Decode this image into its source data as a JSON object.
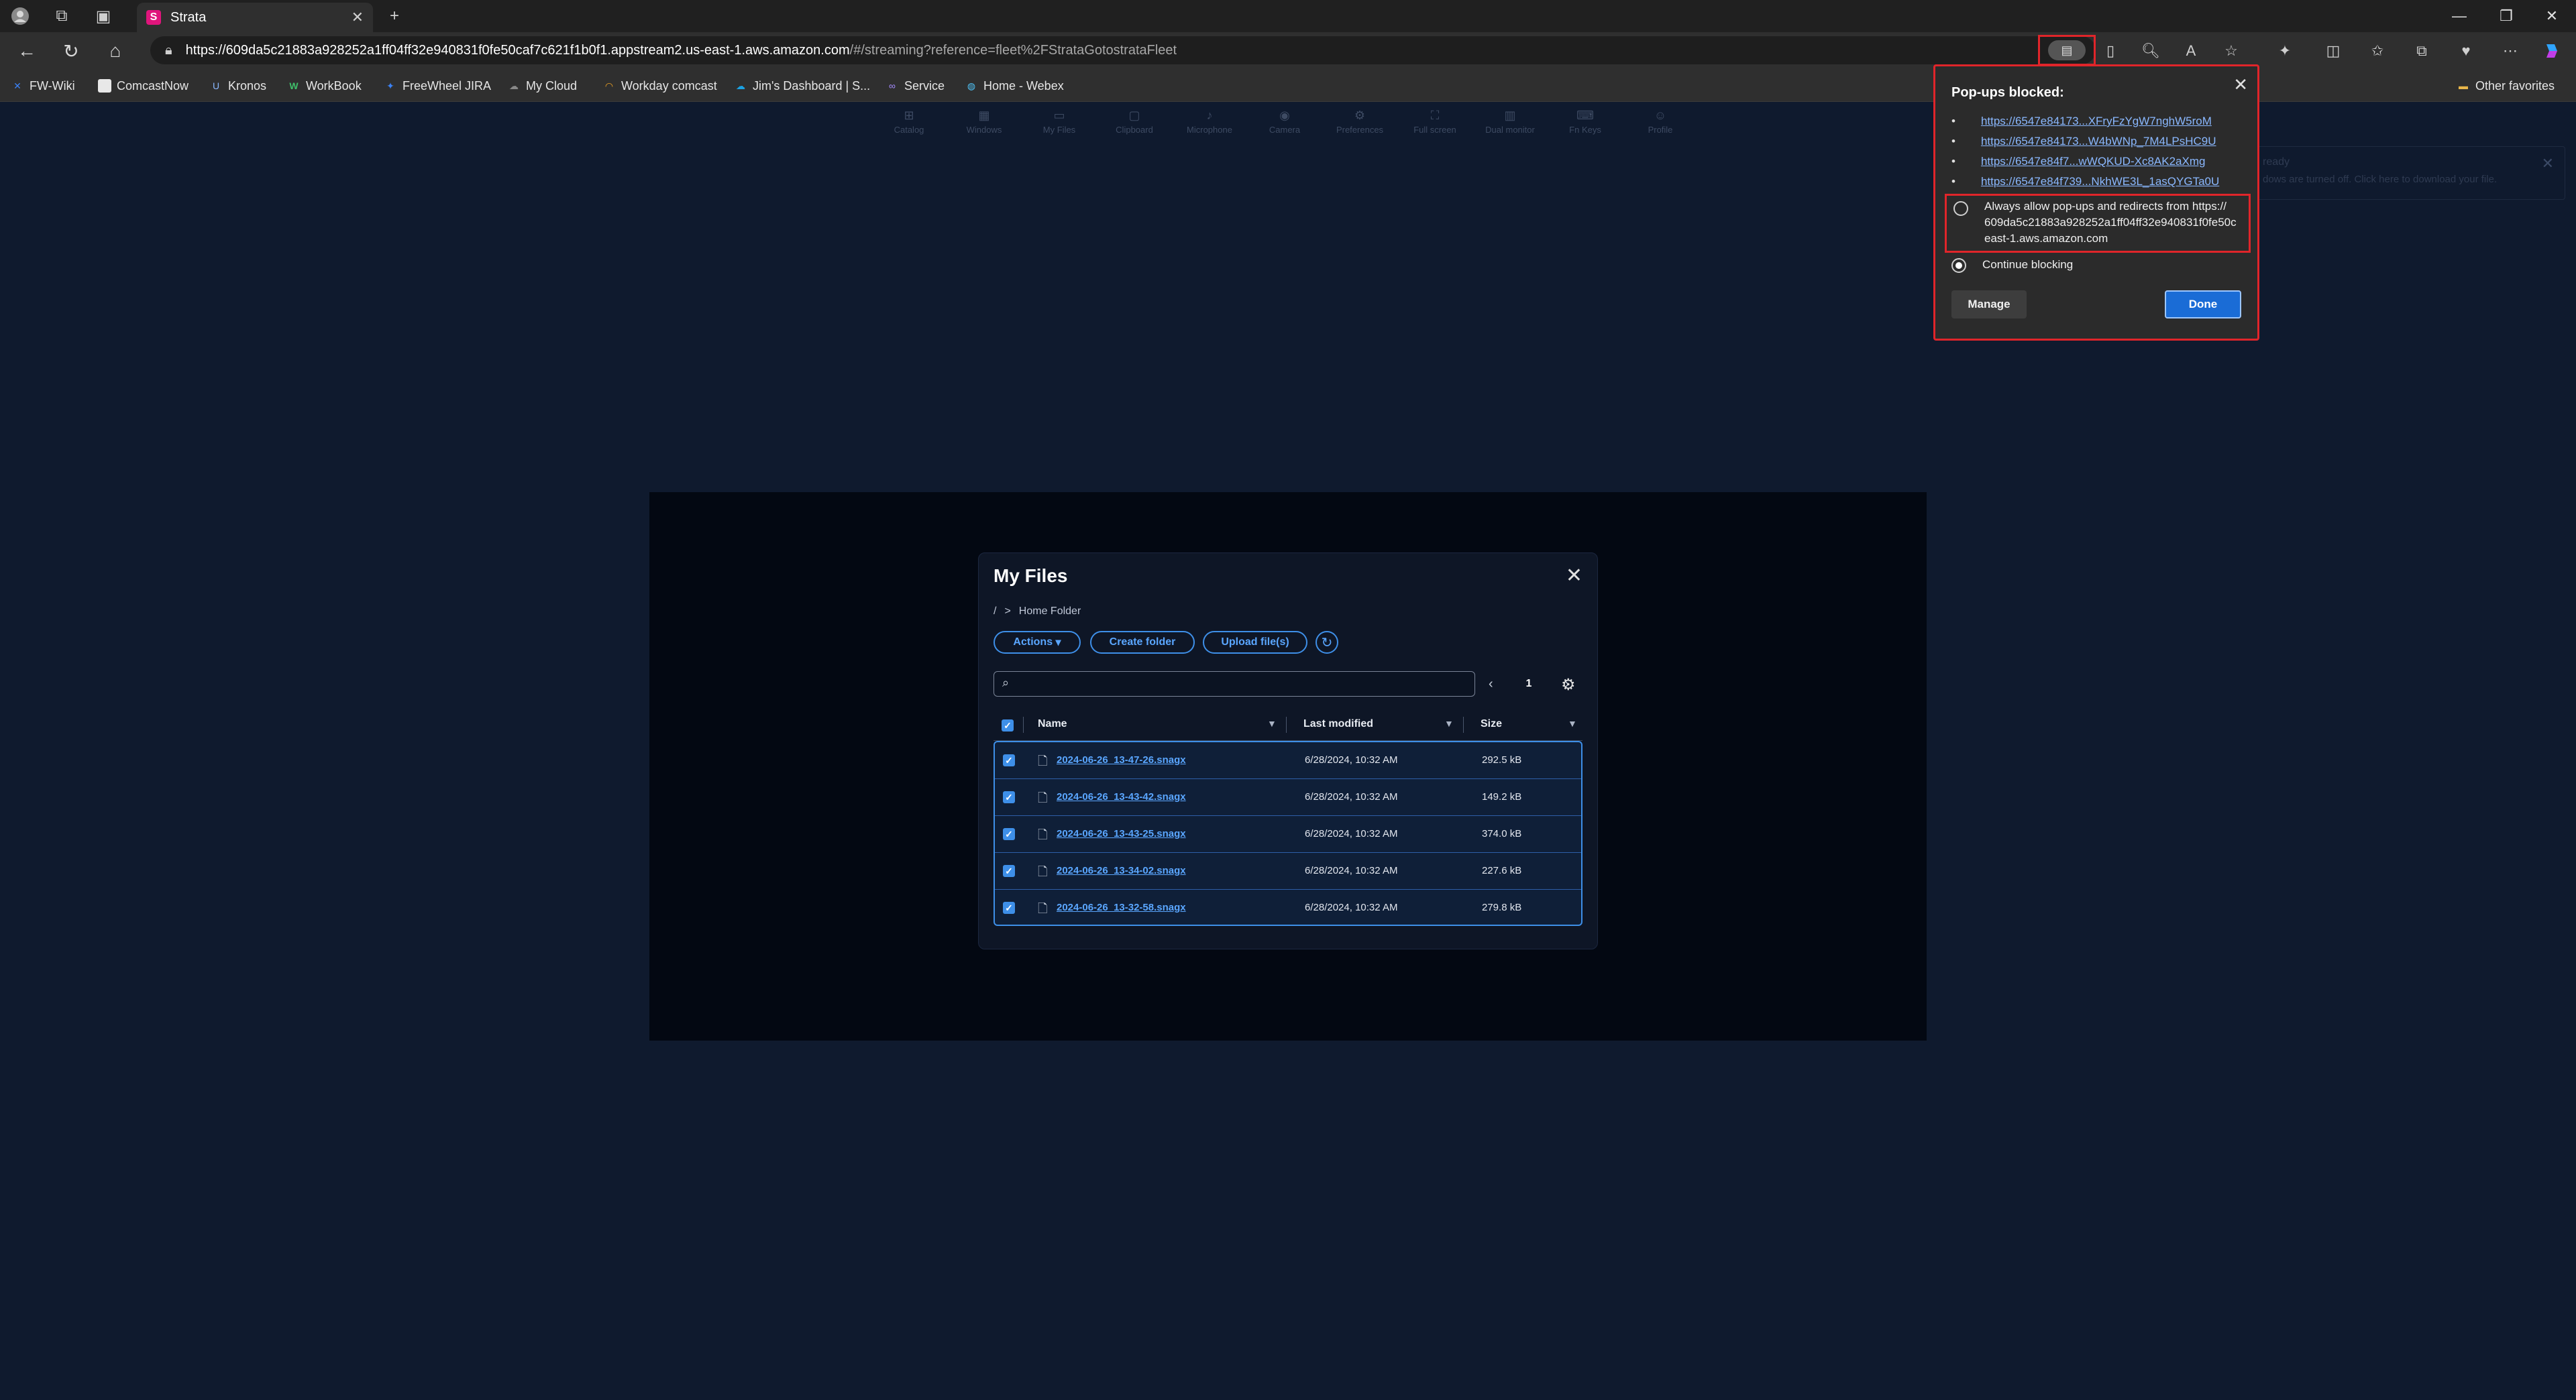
{
  "browser": {
    "tab_title": "Strata",
    "tab_favicon": "S",
    "url_host": "https://609da5c21883a928252a1ff04ff32e940831f0fe50caf7c621f1b0f1.appstream2.us-east-1.aws.amazon.com",
    "url_path": "/#/streaming?reference=fleet%2FStrataGotostrataFleet",
    "favorites": [
      {
        "label": "FW-Wiki",
        "icon": "fw-icon"
      },
      {
        "label": "ComcastNow",
        "icon": "page-icon"
      },
      {
        "label": "Kronos",
        "icon": "kronos-icon"
      },
      {
        "label": "WorkBook",
        "icon": "workbook-icon"
      },
      {
        "label": "FreeWheel JIRA",
        "icon": "jira-icon"
      },
      {
        "label": "My Cloud",
        "icon": "cloud-icon"
      },
      {
        "label": "Workday comcast",
        "icon": "workday-icon"
      },
      {
        "label": "Jim's Dashboard | S...",
        "icon": "salesforce-icon"
      },
      {
        "label": "Service",
        "icon": "service-icon"
      },
      {
        "label": "Home - Webex",
        "icon": "webex-icon"
      }
    ],
    "other_favorites": "Other favorites"
  },
  "appstream_toolbar": [
    "Catalog",
    "Windows",
    "My Files",
    "Clipboard",
    "Microphone",
    "Camera",
    "Preferences",
    "Full screen",
    "Dual monitor",
    "Fn Keys",
    "Profile"
  ],
  "notification": {
    "title": "ready",
    "body": "dows are turned off. Click here to download your file."
  },
  "my_files": {
    "title": "My Files",
    "breadcrumb_root": "/",
    "breadcrumb_sep": ">",
    "breadcrumb_folder": "Home Folder",
    "actions_label": "Actions",
    "create_folder_label": "Create folder",
    "upload_label": "Upload file(s)",
    "page_number": "1",
    "columns": {
      "name": "Name",
      "modified": "Last modified",
      "size": "Size"
    },
    "files": [
      {
        "name": "2024-06-26_13-47-26.snagx",
        "modified": "6/28/2024, 10:32 AM",
        "size": "292.5 kB"
      },
      {
        "name": "2024-06-26_13-43-42.snagx",
        "modified": "6/28/2024, 10:32 AM",
        "size": "149.2 kB"
      },
      {
        "name": "2024-06-26_13-43-25.snagx",
        "modified": "6/28/2024, 10:32 AM",
        "size": "374.0 kB"
      },
      {
        "name": "2024-06-26_13-34-02.snagx",
        "modified": "6/28/2024, 10:32 AM",
        "size": "227.6 kB"
      },
      {
        "name": "2024-06-26_13-32-58.snagx",
        "modified": "6/28/2024, 10:32 AM",
        "size": "279.8 kB"
      }
    ]
  },
  "popup_flyout": {
    "title": "Pop-ups blocked:",
    "links": [
      "https://6547e84173...XFryFzYgW7nghW5roM",
      "https://6547e84173...W4bWNp_7M4LPsHC9U",
      "https://6547e84f7...wWQKUD-Xc8AK2aXmg",
      "https://6547e84f739...NkhWE3L_1asQYGTa0U"
    ],
    "always_allow_line1": "Always allow pop-ups and redirects from https://",
    "always_allow_line2": "609da5c21883a928252a1ff04ff32e940831f0fe50c",
    "always_allow_line3": "east-1.aws.amazon.com",
    "continue_blocking": "Continue blocking",
    "manage_label": "Manage",
    "done_label": "Done"
  },
  "colors": {
    "accent": "#3e8fe8",
    "highlight": "#e0252a",
    "done_button": "#1a6cd6"
  }
}
